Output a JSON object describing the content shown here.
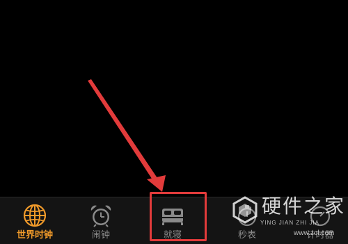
{
  "tabbar": {
    "tabs": [
      {
        "label": "世界时钟",
        "icon": "globe-icon",
        "active": true
      },
      {
        "label": "闹钟",
        "icon": "alarm-clock-icon",
        "active": false
      },
      {
        "label": "就寝",
        "icon": "bed-icon",
        "active": false
      },
      {
        "label": "秒表",
        "icon": "stopwatch-icon",
        "active": false
      },
      {
        "label": "计时器",
        "icon": "timer-icon",
        "active": false
      }
    ]
  },
  "colors": {
    "active": "#f09a2a",
    "inactive": "#8a8a8a",
    "highlight": "#e23b3b",
    "background": "#000000"
  },
  "watermark": {
    "title": "硬件之家",
    "pinyin": "YING JIAN ZHI JIA",
    "url": "www.zol.com"
  }
}
